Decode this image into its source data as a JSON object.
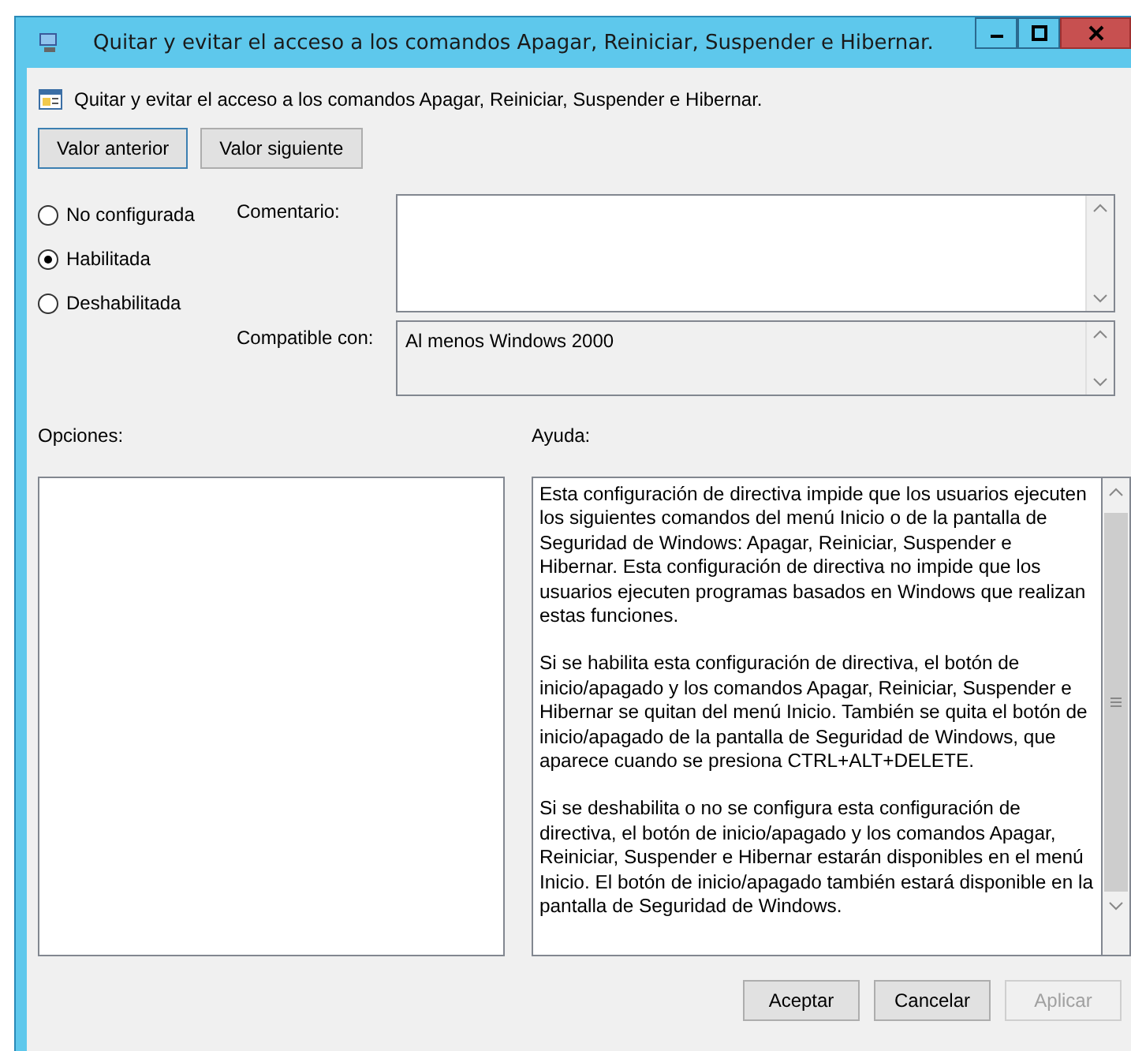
{
  "window": {
    "title": "Quitar y evitar el acceso a los comandos Apagar, Reiniciar, Suspender e Hibernar."
  },
  "header": {
    "title": "Quitar y evitar el acceso a los comandos Apagar, Reiniciar, Suspender e Hibernar."
  },
  "nav_buttons": [
    "Valor anterior",
    "Valor siguiente"
  ],
  "states": [
    {
      "label": "No configurada",
      "selected": false
    },
    {
      "label": "Habilitada",
      "selected": true
    },
    {
      "label": "Deshabilitada",
      "selected": false
    }
  ],
  "comment": {
    "label": "Comentario:"
  },
  "compatible": {
    "label": "Compatible con:",
    "value": "Al menos Windows 2000"
  },
  "options": {
    "label": "Opciones:"
  },
  "help": {
    "label": "Ayuda:",
    "paragraphs": [
      "Esta configuración de directiva impide que los usuarios ejecuten los siguientes comandos del menú Inicio o de la pantalla de Seguridad de Windows: Apagar, Reiniciar, Suspender e Hibernar. Esta configuración de directiva no impide que los usuarios ejecuten programas basados en Windows que realizan estas funciones.",
      "Si se habilita esta configuración de directiva, el botón de inicio/apagado y los comandos Apagar, Reiniciar, Suspender e Hibernar se quitan del menú Inicio. También se quita el botón de inicio/apagado de la pantalla de Seguridad de Windows, que aparece cuando se presiona CTRL+ALT+DELETE.",
      "Si se deshabilita o no se configura esta configuración de directiva, el botón de inicio/apagado y los comandos Apagar, Reiniciar, Suspender e Hibernar estarán disponibles en el menú Inicio. El botón de inicio/apagado también estará disponible en la pantalla de Seguridad de Windows."
    ]
  },
  "footer_buttons": [
    {
      "label": "Aceptar",
      "disabled": false
    },
    {
      "label": "Cancelar",
      "disabled": false
    },
    {
      "label": "Aplicar",
      "disabled": true
    }
  ]
}
